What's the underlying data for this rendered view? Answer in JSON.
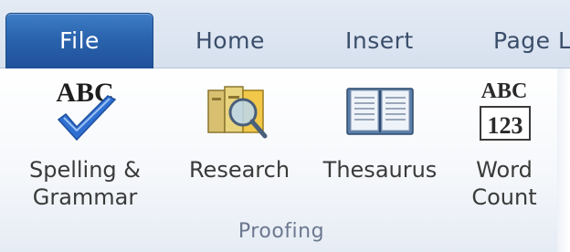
{
  "tabs": {
    "file": "File",
    "home": "Home",
    "insert": "Insert",
    "page_layout": "Page L"
  },
  "proofing": {
    "group_label": "Proofing",
    "spelling": {
      "line1": "Spelling &",
      "line2": "Grammar",
      "icon": "spelling-grammar-icon",
      "icon_text": "ABC"
    },
    "research": {
      "line1": "Research",
      "icon": "research-icon"
    },
    "thesaurus": {
      "line1": "Thesaurus",
      "icon": "thesaurus-icon"
    },
    "word_count": {
      "line1": "Word",
      "line2": "Count",
      "icon": "word-count-icon",
      "icon_top": "ABC",
      "icon_bottom": "123"
    }
  },
  "colors": {
    "file_tab": "#2a63ae",
    "tab_text": "#3a4d6a",
    "group_label": "#6c7890",
    "checkmark": "#2f6fd1"
  }
}
